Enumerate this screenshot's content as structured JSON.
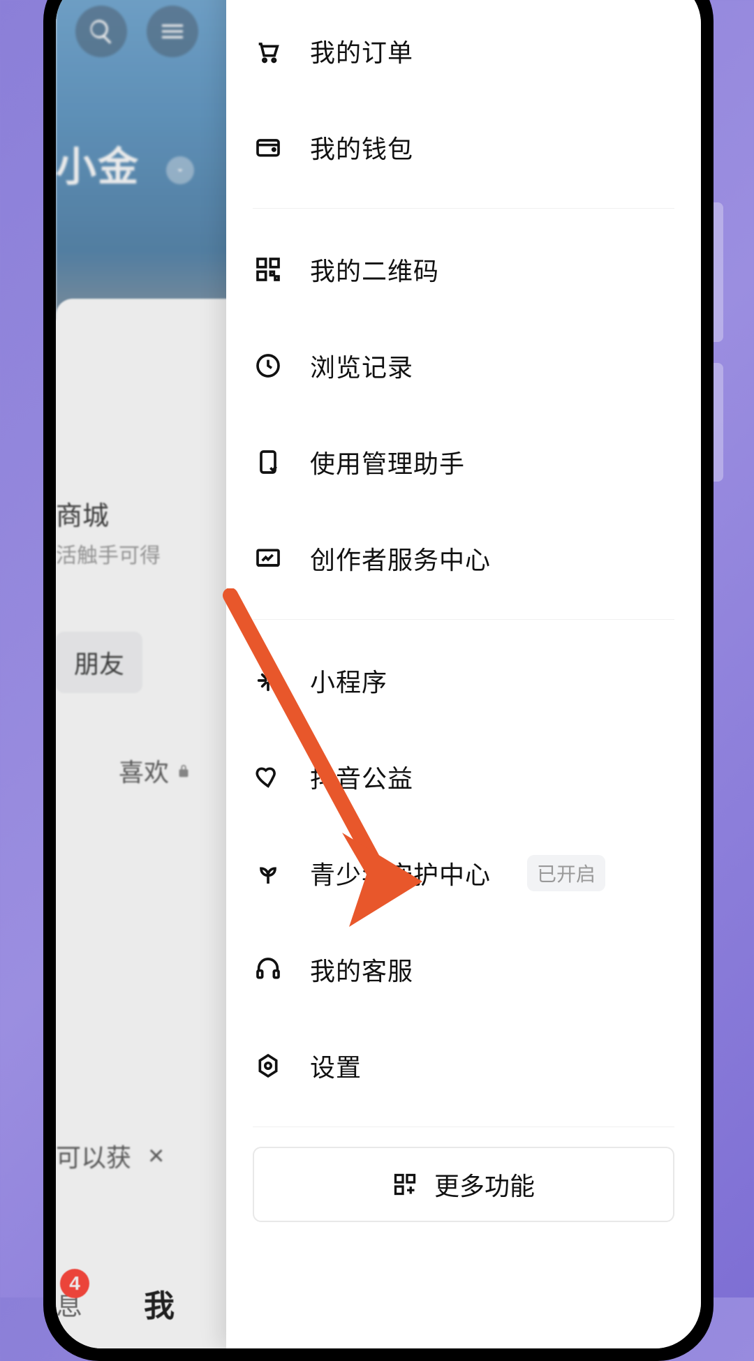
{
  "background": {
    "profile_name_partial": "小金",
    "mall_title_partial": "商城",
    "mall_sub_partial": "活触手可得",
    "friend_chip_partial": "朋友",
    "liked_label": "喜欢",
    "tip_partial": "可以获",
    "tab_msg_partial": "息",
    "tab_msg_badge": "4",
    "tab_me": "我"
  },
  "drawer": {
    "group1": [
      {
        "key": "orders",
        "label": "我的订单"
      },
      {
        "key": "wallet",
        "label": "我的钱包"
      }
    ],
    "group2": [
      {
        "key": "qrcode",
        "label": "我的二维码"
      },
      {
        "key": "history",
        "label": "浏览记录"
      },
      {
        "key": "usage",
        "label": "使用管理助手"
      },
      {
        "key": "creator",
        "label": "创作者服务中心"
      }
    ],
    "group3": [
      {
        "key": "miniprogram",
        "label": "小程序"
      },
      {
        "key": "charity",
        "label": "抖音公益"
      },
      {
        "key": "teen",
        "label": "青少年守护中心",
        "badge": "已开启"
      },
      {
        "key": "support",
        "label": "我的客服"
      },
      {
        "key": "settings",
        "label": "设置"
      }
    ],
    "more_button": "更多功能"
  }
}
